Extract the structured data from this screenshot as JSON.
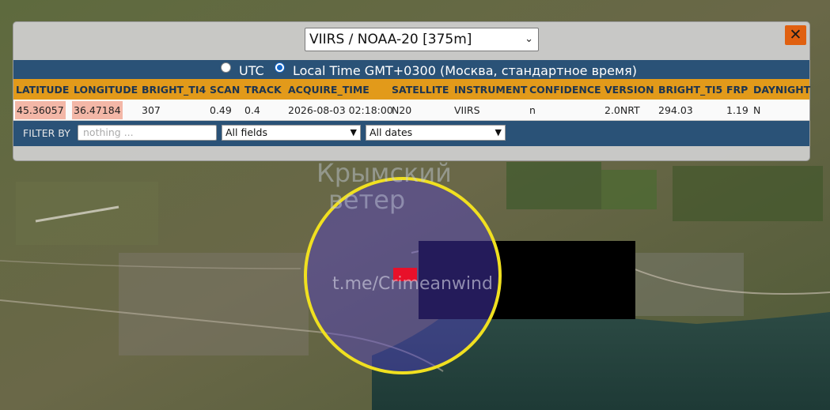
{
  "satellite_select": {
    "value": "VIIRS / NOAA-20 [375m]"
  },
  "close_label": "✕",
  "time_options": {
    "utc_label": "UTC",
    "local_label": "Local Time GMT+0300 (Москва, стандартное время)",
    "selected": "local"
  },
  "table": {
    "columns": [
      "LATITUDE",
      "LONGITUDE",
      "BRIGHT_TI4",
      "SCAN",
      "TRACK",
      "ACQUIRE_TIME",
      "SATELLITE",
      "INSTRUMENT",
      "CONFIDENCE",
      "VERSION",
      "BRIGHT_TI5",
      "FRP",
      "DAYNIGHT"
    ],
    "rows": [
      [
        "45.36057",
        "36.47184",
        "307",
        "0.49",
        "0.4",
        "2026-08-03 02:18:00",
        "N20",
        "VIIRS",
        "n",
        "2.0NRT",
        "294.03",
        "1.19",
        "N"
      ]
    ]
  },
  "filter": {
    "label": "FILTER BY",
    "placeholder": "nothing ...",
    "field_select": "All fields",
    "date_select": "All dates"
  },
  "watermark": {
    "line1": "Крымский",
    "line2": "ветер",
    "handle": "t.me/Crimeanwind"
  },
  "colors": {
    "header_bg": "#e29a1a",
    "bar_bg": "#2a5277",
    "highlight_circle": "#f0e020",
    "hotspot": "#e8102a",
    "close_bg": "#e06010"
  }
}
